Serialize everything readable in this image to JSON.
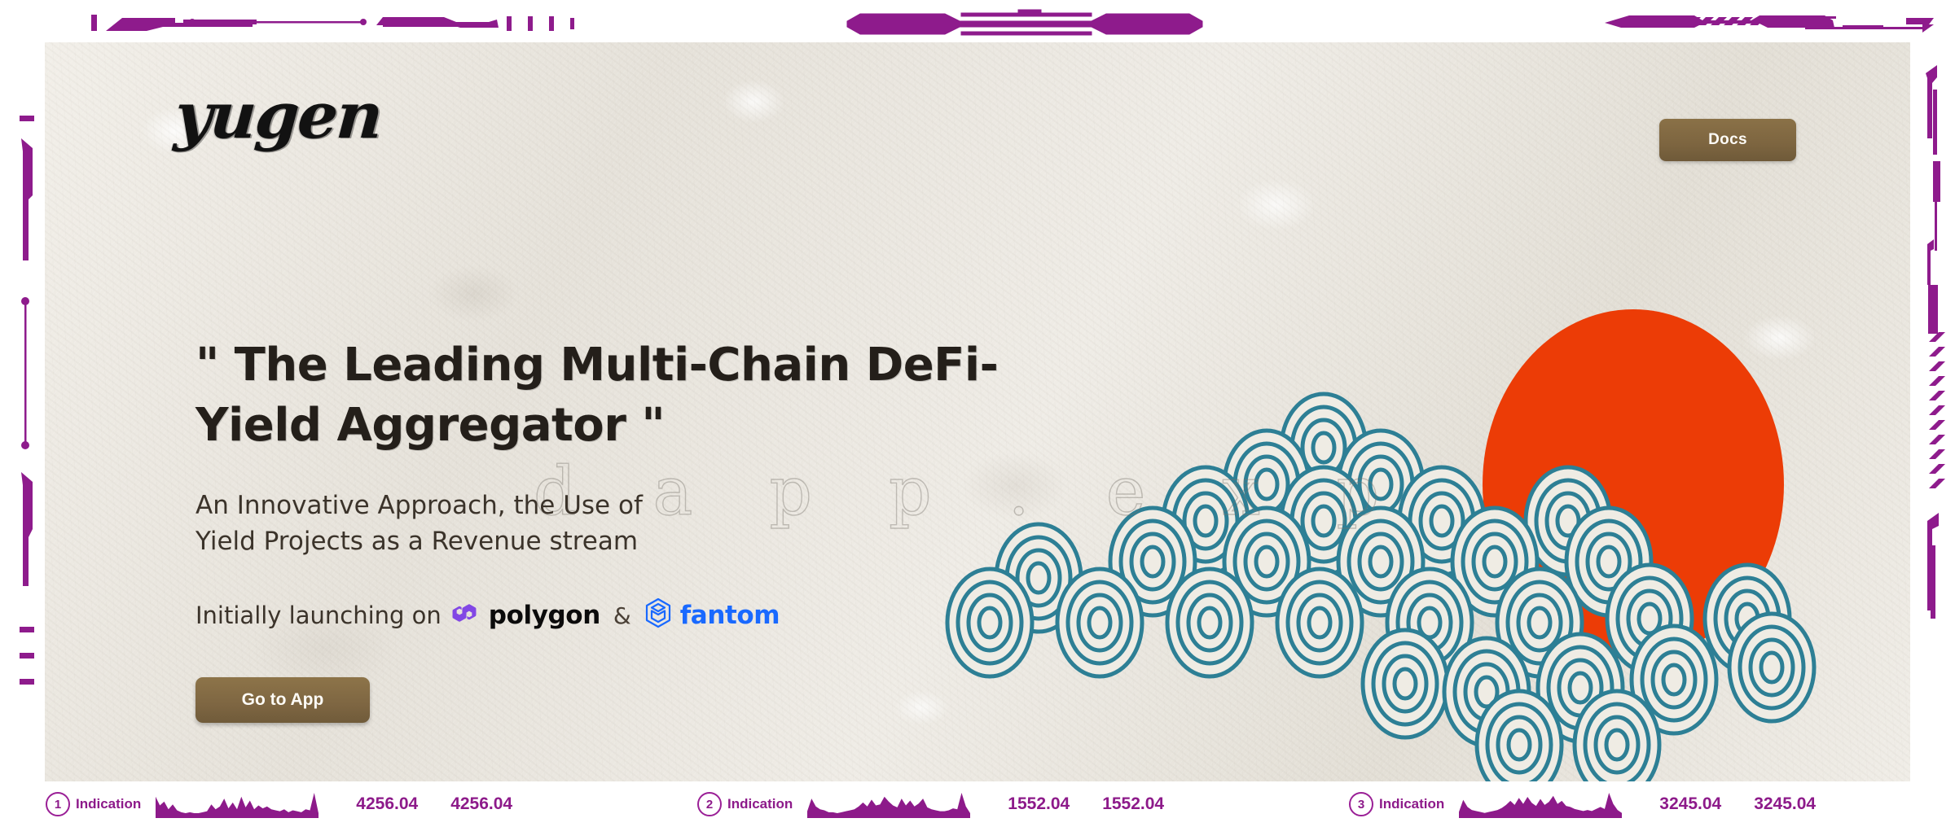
{
  "brand": {
    "logo_text": "yugen",
    "logo_icon": "yugen-wordmark"
  },
  "nav": {
    "docs_label": "Docs"
  },
  "hero": {
    "headline": "\" The Leading Multi-Chain DeFi-Yield Aggregator \"",
    "subline": "An Innovative Approach, the Use of Yield Projects as a Revenue stream",
    "launching_prefix": "Initially launching on",
    "polygon_label": "polygon",
    "ampersand": "&",
    "fantom_label": "fantom",
    "cta_label": "Go to App",
    "watermark": "d a p p . e x p"
  },
  "artwork": {
    "sun_color": "#ec3c06",
    "cloud_color": "#2d7f95",
    "cloud_fill": "#efece4"
  },
  "colors": {
    "accent_brown": "#7d6540",
    "ticker_purple": "#8d1a8a",
    "deco_purple": "#8e1b8c",
    "polygon": "#8247e5",
    "fantom": "#1969ff",
    "paper": "#eae7e0"
  },
  "footer": {
    "tickers": [
      {
        "index": "1",
        "label": "Indication",
        "value_a": "4256.04",
        "value_b": "4256.04",
        "spark": [
          22,
          13,
          17,
          9,
          14,
          8,
          6,
          5,
          6,
          5,
          5,
          6,
          7,
          14,
          9,
          12,
          20,
          10,
          16,
          9,
          22,
          11,
          18,
          9,
          13,
          10,
          12,
          9,
          8,
          7,
          9,
          6,
          8,
          7,
          6,
          9,
          8,
          26,
          5
        ]
      },
      {
        "index": "2",
        "label": "Indication",
        "value_a": "1552.04",
        "value_b": "1552.04",
        "spark": [
          7,
          20,
          12,
          9,
          8,
          6,
          6,
          5,
          6,
          7,
          8,
          9,
          12,
          16,
          12,
          19,
          13,
          14,
          22,
          17,
          13,
          11,
          20,
          13,
          18,
          12,
          15,
          20,
          11,
          9,
          8,
          7,
          7,
          8,
          10,
          9,
          26,
          12,
          5
        ]
      },
      {
        "index": "3",
        "label": "Indication",
        "value_a": "3245.04",
        "value_b": "3245.04",
        "spark": [
          6,
          18,
          11,
          8,
          7,
          6,
          5,
          6,
          7,
          8,
          10,
          13,
          17,
          13,
          20,
          14,
          21,
          15,
          12,
          19,
          13,
          16,
          22,
          14,
          17,
          12,
          11,
          9,
          8,
          7,
          8,
          7,
          9,
          11,
          9,
          25,
          14,
          8,
          5
        ]
      }
    ]
  }
}
